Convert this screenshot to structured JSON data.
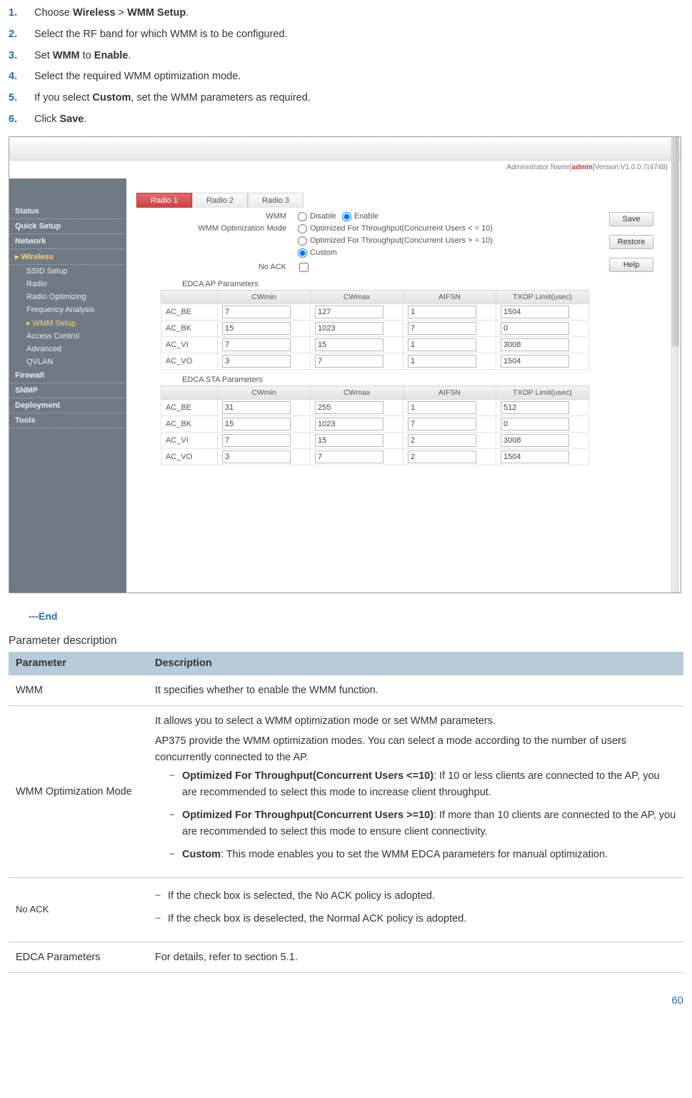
{
  "steps": [
    {
      "plain_before": "Choose ",
      "bold1": "Wireless",
      "middle": " > ",
      "bold2": "WMM Setup",
      "after": "."
    },
    {
      "plain_before": "Select the RF band for which WMM is to be configured.",
      "bold1": "",
      "middle": "",
      "bold2": "",
      "after": ""
    },
    {
      "plain_before": "Set ",
      "bold1": "WMM",
      "middle": " to ",
      "bold2": "Enable",
      "after": "."
    },
    {
      "plain_before": "Select the required WMM optimization mode.",
      "bold1": "",
      "middle": "",
      "bold2": "",
      "after": ""
    },
    {
      "plain_before": "If you select ",
      "bold1": "Custom",
      "middle": ", set the WMM parameters as required.",
      "bold2": "",
      "after": ""
    },
    {
      "plain_before": "Click ",
      "bold1": "Save",
      "middle": ".",
      "bold2": "",
      "after": ""
    }
  ],
  "screenshot": {
    "admin_prefix": "Administrator Name[",
    "admin_name": "admin",
    "admin_suffix": "]Version:V1.0.0.7(4748)",
    "sidebar": {
      "cats": [
        "Status",
        "Quick Setup",
        "Network",
        "Wireless",
        "Firewall",
        "SNMP",
        "Deployment",
        "Tools"
      ],
      "wireless_children": [
        "SSID Setup",
        "Radio",
        "Radio Optimizing",
        "Frequency Analysis",
        "WMM Setup",
        "Access Control",
        "Advanced",
        "QVLAN"
      ]
    },
    "tabs": [
      "Radio 1",
      "Radio 2",
      "Radio 3"
    ],
    "buttons": {
      "save": "Save",
      "restore": "Restore",
      "help": "Help"
    },
    "labels": {
      "wmm": "WMM",
      "wmm_opt": "WMM Optimization Mode",
      "noack": "No ACK",
      "edca_ap": "EDCA AP Parameters",
      "edca_sta": "EDCA STA Parameters",
      "disable": "Disable",
      "enable": "Enable",
      "opt10": "Optimized For Throughput(Concurrent Users < = 10)",
      "opt10b": "Optimized For Throughput(Concurrent Users > = 10)",
      "custom": "Custom"
    },
    "table_headers": [
      "",
      "CWmin",
      "CWmax",
      "AIFSN",
      "TXOP Limit(usec)"
    ],
    "ap": [
      {
        "name": "AC_BE",
        "cwmin": "7",
        "cwmax": "127",
        "aifsn": "1",
        "txop": "1504"
      },
      {
        "name": "AC_BK",
        "cwmin": "15",
        "cwmax": "1023",
        "aifsn": "7",
        "txop": "0"
      },
      {
        "name": "AC_VI",
        "cwmin": "7",
        "cwmax": "15",
        "aifsn": "1",
        "txop": "3008"
      },
      {
        "name": "AC_VO",
        "cwmin": "3",
        "cwmax": "7",
        "aifsn": "1",
        "txop": "1504"
      }
    ],
    "sta": [
      {
        "name": "AC_BE",
        "cwmin": "31",
        "cwmax": "255",
        "aifsn": "1",
        "txop": "512"
      },
      {
        "name": "AC_BK",
        "cwmin": "15",
        "cwmax": "1023",
        "aifsn": "7",
        "txop": "0"
      },
      {
        "name": "AC_VI",
        "cwmin": "7",
        "cwmax": "15",
        "aifsn": "2",
        "txop": "3008"
      },
      {
        "name": "AC_VO",
        "cwmin": "3",
        "cwmax": "7",
        "aifsn": "2",
        "txop": "1504"
      }
    ]
  },
  "end": "---End",
  "pdesc": {
    "title": "Parameter description",
    "headers": {
      "param": "Parameter",
      "desc": "Description"
    },
    "rows": {
      "wmm": {
        "p": "WMM",
        "d": "It specifies whether to enable the WMM function."
      },
      "mode": {
        "p": "WMM Optimization Mode",
        "intro1": "It allows you to select a WMM optimization mode or set WMM parameters.",
        "intro2": "AP375 provide the WMM optimization modes. You can select a mode according to the number of users concurrently connected to the AP.",
        "b1_bold": "Optimized For Throughput(Concurrent Users <=10)",
        "b1_text": ": If 10 or less clients are connected to the AP, you are recommended to select this mode to increase client throughput.",
        "b2_bold": "Optimized For Throughput(Concurrent Users >=10)",
        "b2_text": ": If more than 10 clients are connected to the AP, you are recommended to select this mode to ensure client connectivity.",
        "b3_bold": "Custom",
        "b3_text": ": This mode enables you to set the WMM EDCA parameters for manual optimization."
      },
      "noack": {
        "p": "No ACK",
        "b1": "If the check box is selected, the No ACK policy is adopted.",
        "b2": "If the check box is deselected, the Normal ACK policy is adopted."
      },
      "edca": {
        "p": "EDCA Parameters",
        "d": "For details, refer to section 5.1."
      }
    }
  },
  "page_number": "60"
}
